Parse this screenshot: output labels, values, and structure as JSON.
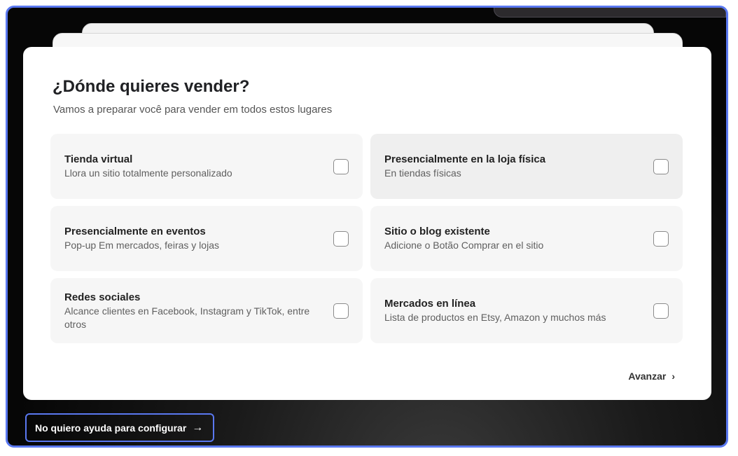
{
  "dialog": {
    "title": "¿Dónde quieres vender?",
    "subtitle": "Vamos a preparar você para vender em todos estos lugares",
    "options": [
      {
        "name": "Tienda virtual",
        "desc": "Llora un sitio totalmente personalizado",
        "checked": false
      },
      {
        "name": "Presencialmente en la loja física",
        "desc": "En tiendas físicas",
        "checked": false
      },
      {
        "name": "Presencialmente en eventos",
        "desc": "Pop-up Em mercados, feiras y lojas",
        "checked": false
      },
      {
        "name": "Sitio o blog existente",
        "desc": "Adicione o Botão Comprar en el sitio",
        "checked": false
      },
      {
        "name": "Redes sociales",
        "desc": "Alcance clientes en Facebook, Instagram y TikTok, entre otros",
        "checked": false
      },
      {
        "name": "Mercados en línea",
        "desc": "Lista de productos en Etsy, Amazon y muchos más",
        "checked": false
      }
    ],
    "next_label": "Avanzar",
    "next_icon": "›"
  },
  "skip": {
    "label": "No quiero ayuda para configurar",
    "icon": "→"
  }
}
